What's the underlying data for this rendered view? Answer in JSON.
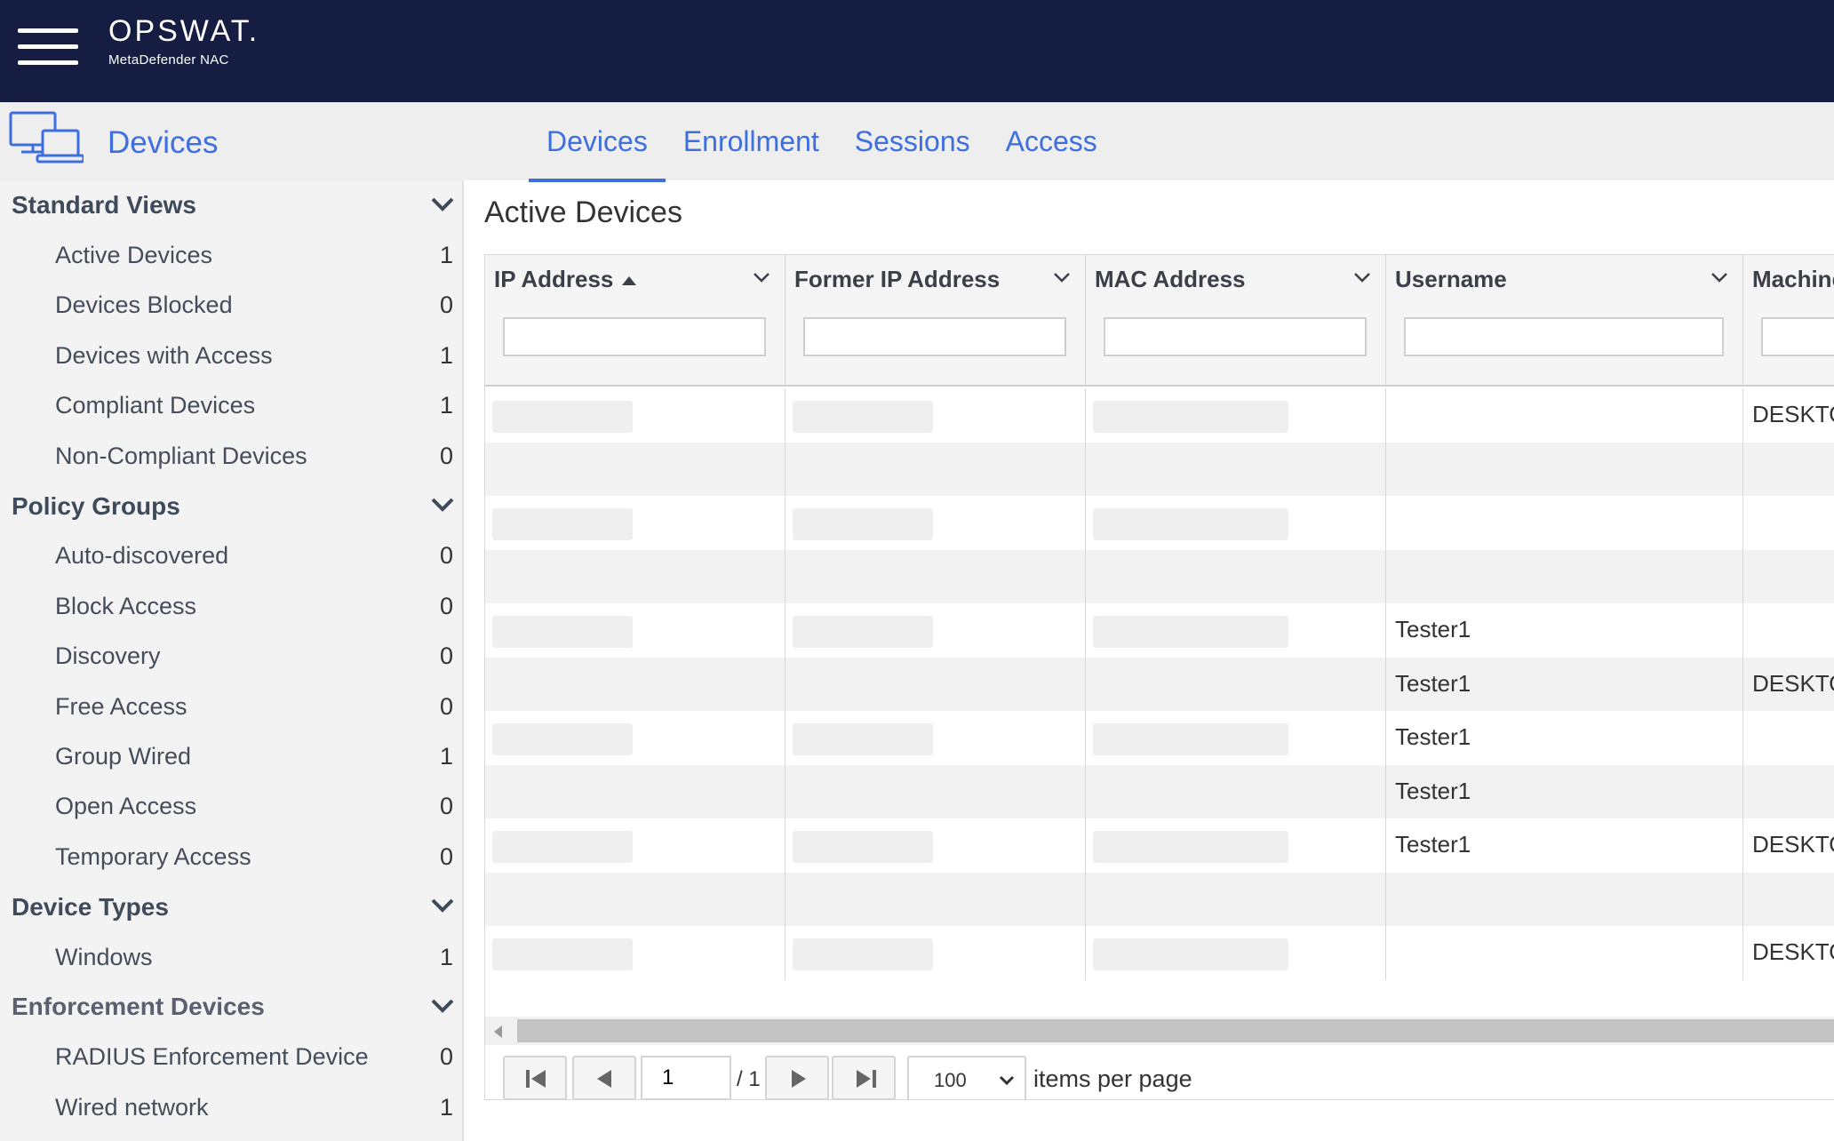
{
  "brand": {
    "name": "OPSWAT.",
    "product": "MetaDefender NAC"
  },
  "header": {
    "title": "Devices"
  },
  "tabs": [
    {
      "label": "Devices",
      "active": true
    },
    {
      "label": "Enrollment",
      "active": false
    },
    {
      "label": "Sessions",
      "active": false
    },
    {
      "label": "Access",
      "active": false
    }
  ],
  "sidebar": {
    "groups": [
      {
        "title": "Standard Views",
        "items": [
          {
            "label": "Active Devices",
            "count": "1"
          },
          {
            "label": "Devices Blocked",
            "count": "0"
          },
          {
            "label": "Devices with Access",
            "count": "1"
          },
          {
            "label": "Compliant Devices",
            "count": "1"
          },
          {
            "label": "Non-Compliant Devices",
            "count": "0"
          }
        ]
      },
      {
        "title": "Policy Groups",
        "items": [
          {
            "label": "Auto-discovered",
            "count": "0"
          },
          {
            "label": "Block Access",
            "count": "0"
          },
          {
            "label": "Discovery",
            "count": "0"
          },
          {
            "label": "Free Access",
            "count": "0"
          },
          {
            "label": "Group Wired",
            "count": "1"
          },
          {
            "label": "Open Access",
            "count": "0"
          },
          {
            "label": "Temporary Access",
            "count": "0"
          }
        ]
      },
      {
        "title": "Device Types",
        "items": [
          {
            "label": "Windows",
            "count": "1"
          }
        ]
      },
      {
        "title": "Enforcement Devices",
        "items": [
          {
            "label": "RADIUS Enforcement Device",
            "count": "0"
          },
          {
            "label": "Wired network",
            "count": "1"
          }
        ]
      }
    ]
  },
  "main": {
    "title": "Active Devices",
    "columns": [
      {
        "label": "IP Address",
        "sorted": "asc"
      },
      {
        "label": "Former IP Address"
      },
      {
        "label": "MAC Address"
      },
      {
        "label": "Username"
      },
      {
        "label": "Machine"
      }
    ],
    "rows": [
      {
        "redacted": true,
        "username": "",
        "machine": "DESKTO"
      },
      {
        "redacted": false,
        "username": "",
        "machine": ""
      },
      {
        "redacted": true,
        "username": "",
        "machine": ""
      },
      {
        "redacted": false,
        "username": "",
        "machine": ""
      },
      {
        "redacted": true,
        "username": "Tester1",
        "machine": ""
      },
      {
        "redacted": false,
        "username": "Tester1",
        "machine": "DESKTO"
      },
      {
        "redacted": true,
        "username": "Tester1",
        "machine": ""
      },
      {
        "redacted": false,
        "username": "Tester1",
        "machine": ""
      },
      {
        "redacted": true,
        "username": "Tester1",
        "machine": "DESKTO"
      },
      {
        "redacted": false,
        "username": "",
        "machine": ""
      },
      {
        "redacted": true,
        "username": "",
        "machine": "DESKTO"
      }
    ]
  },
  "pager": {
    "current_page": "1",
    "total_pages": "/ 1",
    "per_page": "100",
    "per_page_label": "items per page"
  }
}
